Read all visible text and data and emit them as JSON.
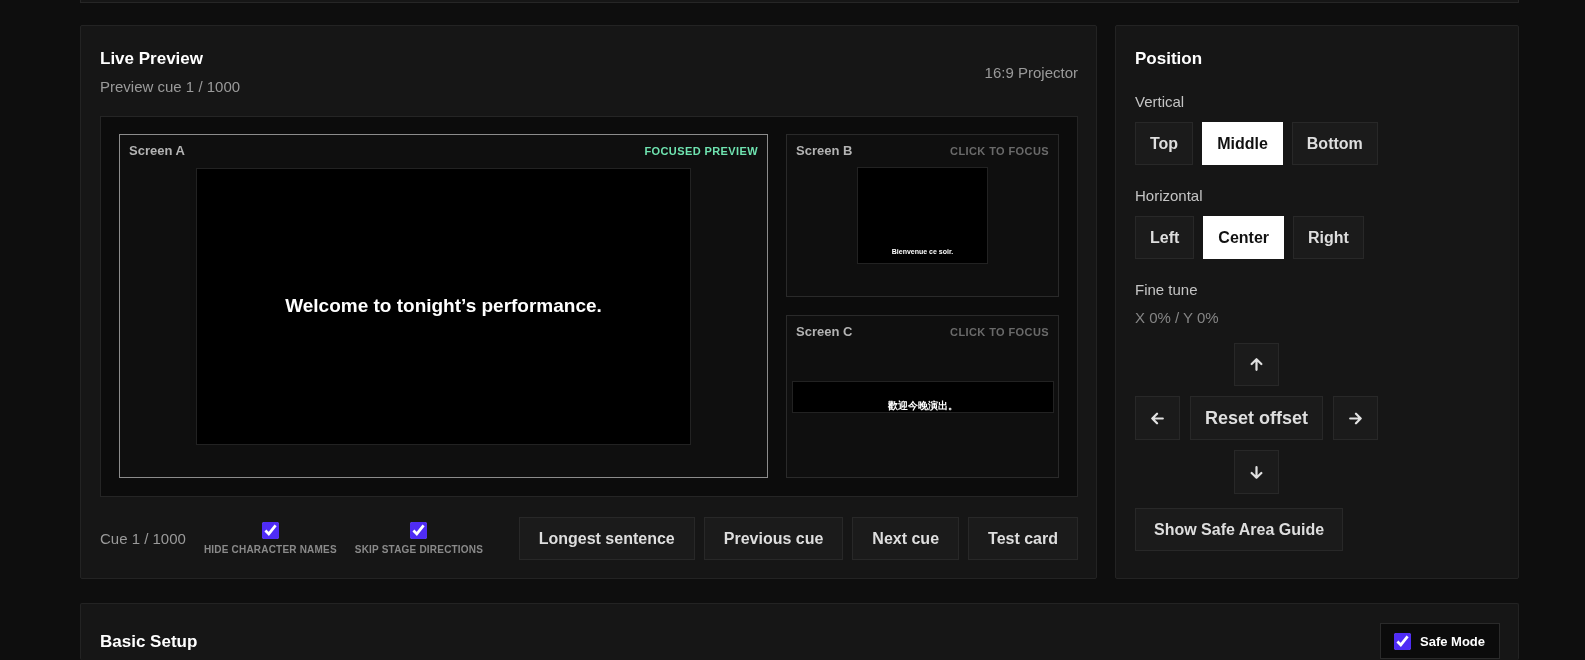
{
  "live_preview": {
    "title": "Live Preview",
    "subtitle": "Preview cue 1 / 1000",
    "output": "16:9 Projector",
    "screens": [
      {
        "label": "Screen A",
        "status": "FOCUSED PREVIEW",
        "focused": true,
        "caption": "Welcome to tonight’s performance."
      },
      {
        "label": "Screen B",
        "status": "CLICK TO FOCUS",
        "focused": false,
        "caption": "Bienvenue ce soir."
      },
      {
        "label": "Screen C",
        "status": "CLICK TO FOCUS",
        "focused": false,
        "caption": "歡迎今晚演出。"
      }
    ],
    "cue": "Cue 1 / 1000",
    "options": [
      {
        "label": "HIDE CHARACTER NAMES",
        "checked": true
      },
      {
        "label": "SKIP STAGE DIRECTIONS",
        "checked": true
      }
    ],
    "buttons": [
      "Longest sentence",
      "Previous cue",
      "Next cue",
      "Test card"
    ]
  },
  "position": {
    "title": "Position",
    "groups": [
      {
        "label": "Vertical",
        "options": [
          {
            "label": "Top",
            "selected": false
          },
          {
            "label": "Middle",
            "selected": true
          },
          {
            "label": "Bottom",
            "selected": false
          }
        ]
      },
      {
        "label": "Horizontal",
        "options": [
          {
            "label": "Left",
            "selected": false
          },
          {
            "label": "Center",
            "selected": true
          },
          {
            "label": "Right",
            "selected": false
          }
        ]
      }
    ],
    "fine_tune": {
      "label": "Fine tune",
      "reading": "X 0% / Y 0%",
      "reset": "Reset offset"
    },
    "guide_button": "Show Safe Area Guide"
  },
  "basic_setup": {
    "title": "Basic Setup",
    "safe_mode": {
      "label": "Safe Mode",
      "checked": true
    }
  }
}
